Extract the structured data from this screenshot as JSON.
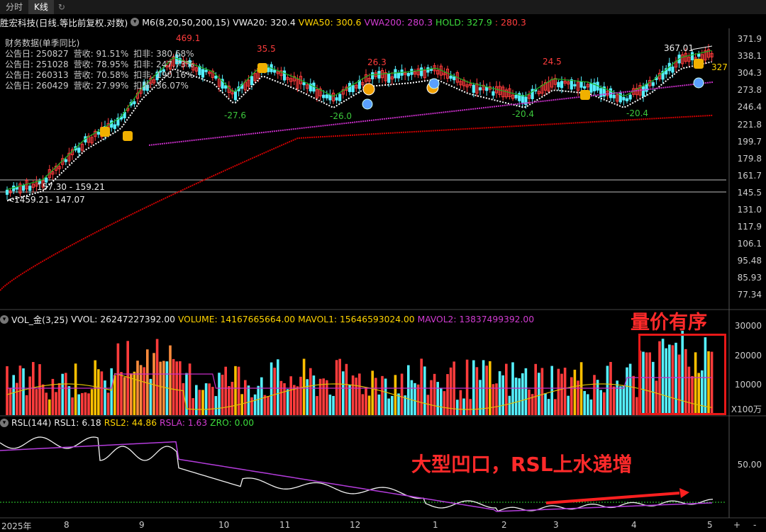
{
  "tabs": [
    "分时",
    "K线"
  ],
  "title": {
    "name": "胜宏科技(日线.等比前复权.对数)",
    "indicator": "M6(8,20,50,200,15)",
    "vwa20": "VWA20: 320.4",
    "vwa50": "VWA50: 300.6",
    "vwa200": "VWA200: 280.3",
    "hold": "HOLD: 327.9",
    "hold2": ": 280.3"
  },
  "fin": {
    "header": "财务数据(单季同比)",
    "rows": [
      {
        "date": "公告日: 250827",
        "rev": "营收:  91.51%",
        "np": "扣非: 380.68%"
      },
      {
        "date": "公告日: 251028",
        "rev": "营收:  78.95%",
        "np": "扣非: 247.73%"
      },
      {
        "date": "公告日: 260313",
        "rev": "营收:  70.58%",
        "np": "扣非: 190.16%"
      },
      {
        "date": "公告日: 260429",
        "rev": "营收:  27.99%",
        "np": "扣非:  36.07%"
      }
    ]
  },
  "price_axis": [
    "371.9",
    "338.1",
    "304.3",
    "273.8",
    "246.4",
    "221.8",
    "199.7",
    "179.8",
    "161.7",
    "145.5",
    "131.0",
    "117.9",
    "106.1",
    "95.48",
    "85.93",
    "77.34"
  ],
  "annotations": {
    "high469": "469.1",
    "h355": "35.5",
    "h263": "26.3",
    "h245": "24.5",
    "l276": "-27.6",
    "l260": "-26.0",
    "l204a": "-20.4",
    "l204b": "-20.4",
    "h36701": "367.01",
    "r327": "327",
    "range1": "157.30 - 159.21",
    "range2": "<1459.21- 147.07"
  },
  "vol": {
    "title": "VOL_金(3,25)",
    "vvol": "VVOL: 26247227392.00",
    "volume": "VOLUME: 14167665664.00",
    "mavol1": "MAVOL1: 15646593024.00",
    "mavol2": "MAVOL2: 13837499392.00",
    "axis": [
      "30000",
      "20000",
      "10000"
    ],
    "unit": "X100万"
  },
  "rsl": {
    "title": "RSL(144)",
    "rsl1": "RSL1: 6.18",
    "rsl2": "RSL2: 44.86",
    "rsla": "RSLA: 1.63",
    "zro": "ZRO: 0.00",
    "axis": "50.00"
  },
  "callouts": {
    "vol": "量价有序",
    "rsl": "大型凹口，RSL上水递增"
  },
  "xaxis": [
    "2025年",
    "8",
    "9",
    "10",
    "11",
    "12",
    "1",
    "2",
    "3",
    "4",
    "5"
  ],
  "toolbar": {
    "plus": "+",
    "minus": "-"
  },
  "colors": {
    "up": "#ff3c3c",
    "down": "#55f0ff",
    "ma200": "#d00000",
    "vwa50": "#c62ec6",
    "hold": "#1fb31f",
    "white": "#ffffff",
    "orange": "#ff8c3c",
    "gold": "#ffc000"
  }
}
